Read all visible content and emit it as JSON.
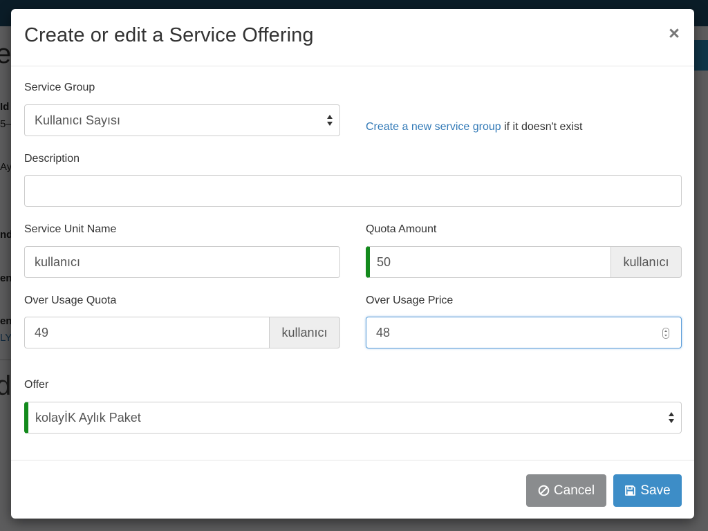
{
  "background": {
    "fragments": [
      "e",
      "Id",
      "5–",
      "Ay",
      "nd",
      "en",
      "en",
      "LY",
      "dl"
    ]
  },
  "modal": {
    "title": "Create or edit a Service Offering",
    "close_label": "×"
  },
  "form": {
    "service_group": {
      "label": "Service Group",
      "value": "Kullanıcı Sayısı"
    },
    "helper": {
      "link_text": "Create a new service group",
      "rest_text": " if it doesn't exist"
    },
    "description": {
      "label": "Description",
      "value": ""
    },
    "service_unit_name": {
      "label": "Service Unit Name",
      "value": "kullanıcı"
    },
    "quota_amount": {
      "label": "Quota Amount",
      "value": "50",
      "addon": "kullanıcı"
    },
    "over_usage_quota": {
      "label": "Over Usage Quota",
      "value": "49",
      "addon": "kullanıcı"
    },
    "over_usage_price": {
      "label": "Over Usage Price",
      "value": "48"
    },
    "offer": {
      "label": "Offer",
      "value": "kolayİK Aylık Paket"
    }
  },
  "footer": {
    "cancel_label": "Cancel",
    "save_label": "Save"
  },
  "colors": {
    "valid_indicator": "#138a1c",
    "link": "#337ab7",
    "cancel_button": "#8a8c8e",
    "save_button": "#3d8dc7"
  }
}
